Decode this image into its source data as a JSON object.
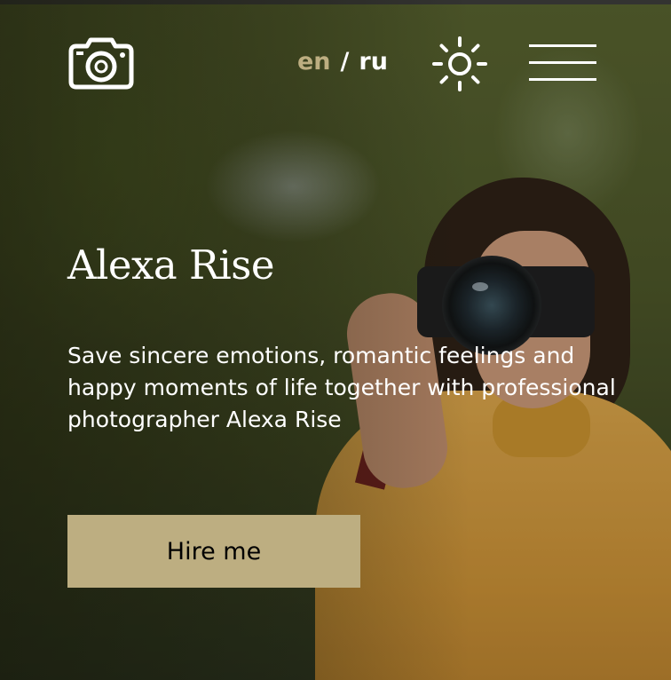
{
  "header": {
    "logo_icon": "camera-icon",
    "languages": [
      {
        "code": "en",
        "active": true
      },
      {
        "code": "ru",
        "active": false
      }
    ],
    "lang_separator": "/",
    "theme_icon": "sun-icon",
    "menu_icon": "hamburger-menu-icon"
  },
  "hero": {
    "title": "Alexa Rise",
    "description": "Save sincere emotions, romantic feelings and happy moments of life together with professional photographer Alexa Rise",
    "cta_label": "Hire me"
  },
  "colors": {
    "accent": "#bdae81",
    "text": "#ffffff",
    "button_text": "#000000"
  }
}
